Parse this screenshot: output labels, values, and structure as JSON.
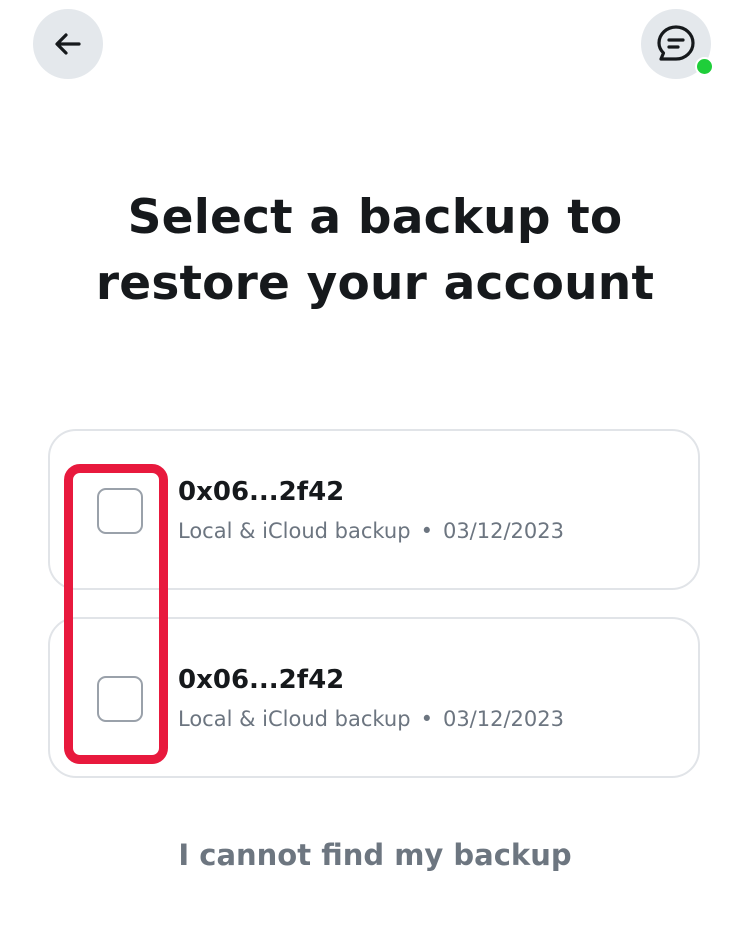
{
  "header": {
    "back_icon": "arrow-left-icon",
    "chat_icon": "chat-bubble-icon",
    "online_color": "#1fce3a"
  },
  "title": {
    "line1": "Select a backup to",
    "line2": "restore your account"
  },
  "backups": [
    {
      "address": "0x06...2f42",
      "type": "Local & iCloud backup",
      "separator": "•",
      "date": "03/12/2023",
      "selected": false
    },
    {
      "address": "0x06...2f42",
      "type": "Local & iCloud backup",
      "separator": "•",
      "date": "03/12/2023",
      "selected": false
    }
  ],
  "footer": {
    "cannot_find_label": "I cannot find my backup"
  },
  "highlight": {
    "color": "#e8193d",
    "target": "backup-checkboxes"
  }
}
